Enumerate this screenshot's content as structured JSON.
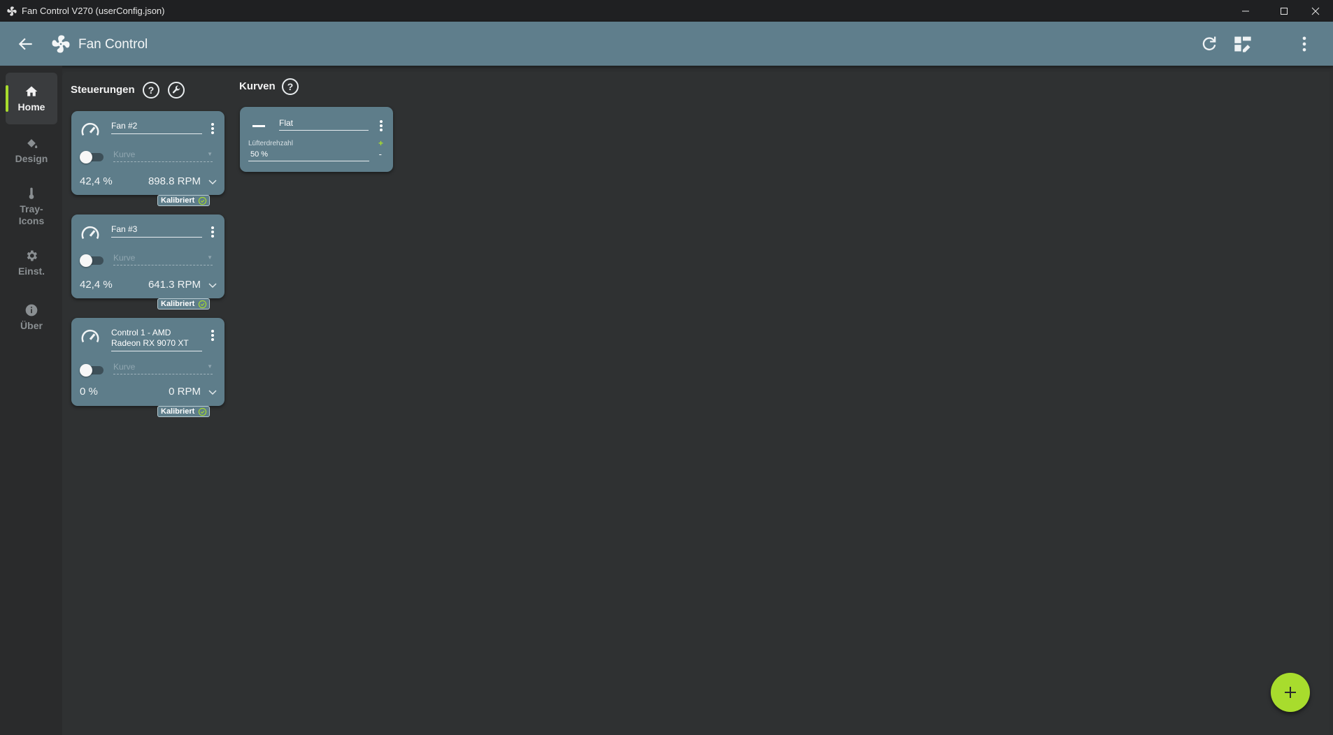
{
  "window": {
    "title": "Fan Control V270 (userConfig.json)"
  },
  "header": {
    "title": "Fan Control"
  },
  "sidebar": {
    "items": [
      {
        "label": "Home",
        "icon": "home-icon",
        "active": true
      },
      {
        "label": "Design",
        "icon": "paint-bucket-icon",
        "active": false
      },
      {
        "label": "Tray-\nIcons",
        "icon": "thermometer-icon",
        "active": false
      },
      {
        "label": "Einst.",
        "icon": "gear-icon",
        "active": false
      },
      {
        "label": "Über",
        "icon": "info-icon",
        "active": false
      }
    ]
  },
  "controls_section": {
    "title": "Steuerungen"
  },
  "curves_section": {
    "title": "Kurven"
  },
  "controls": [
    {
      "name": "Fan #2",
      "curve_placeholder": "Kurve",
      "percent": "42,4 %",
      "rpm": "898.8 RPM",
      "badge": "Kalibriert"
    },
    {
      "name": "Fan #3",
      "curve_placeholder": "Kurve",
      "percent": "42,4 %",
      "rpm": "641.3 RPM",
      "badge": "Kalibriert"
    },
    {
      "name": "Control 1 - AMD Radeon RX 9070 XT",
      "curve_placeholder": "Kurve",
      "percent": "0 %",
      "rpm": "0 RPM",
      "badge": "Kalibriert"
    }
  ],
  "curves": [
    {
      "name": "Flat",
      "field_label": "Lüfterdrehzahl",
      "value": "50 %",
      "increment": "+",
      "decrement": "-"
    }
  ],
  "colors": {
    "accent": "#a8dc2d",
    "header": "#5f7e8c",
    "card": "#5e7d8a",
    "background": "#2d2f30"
  }
}
